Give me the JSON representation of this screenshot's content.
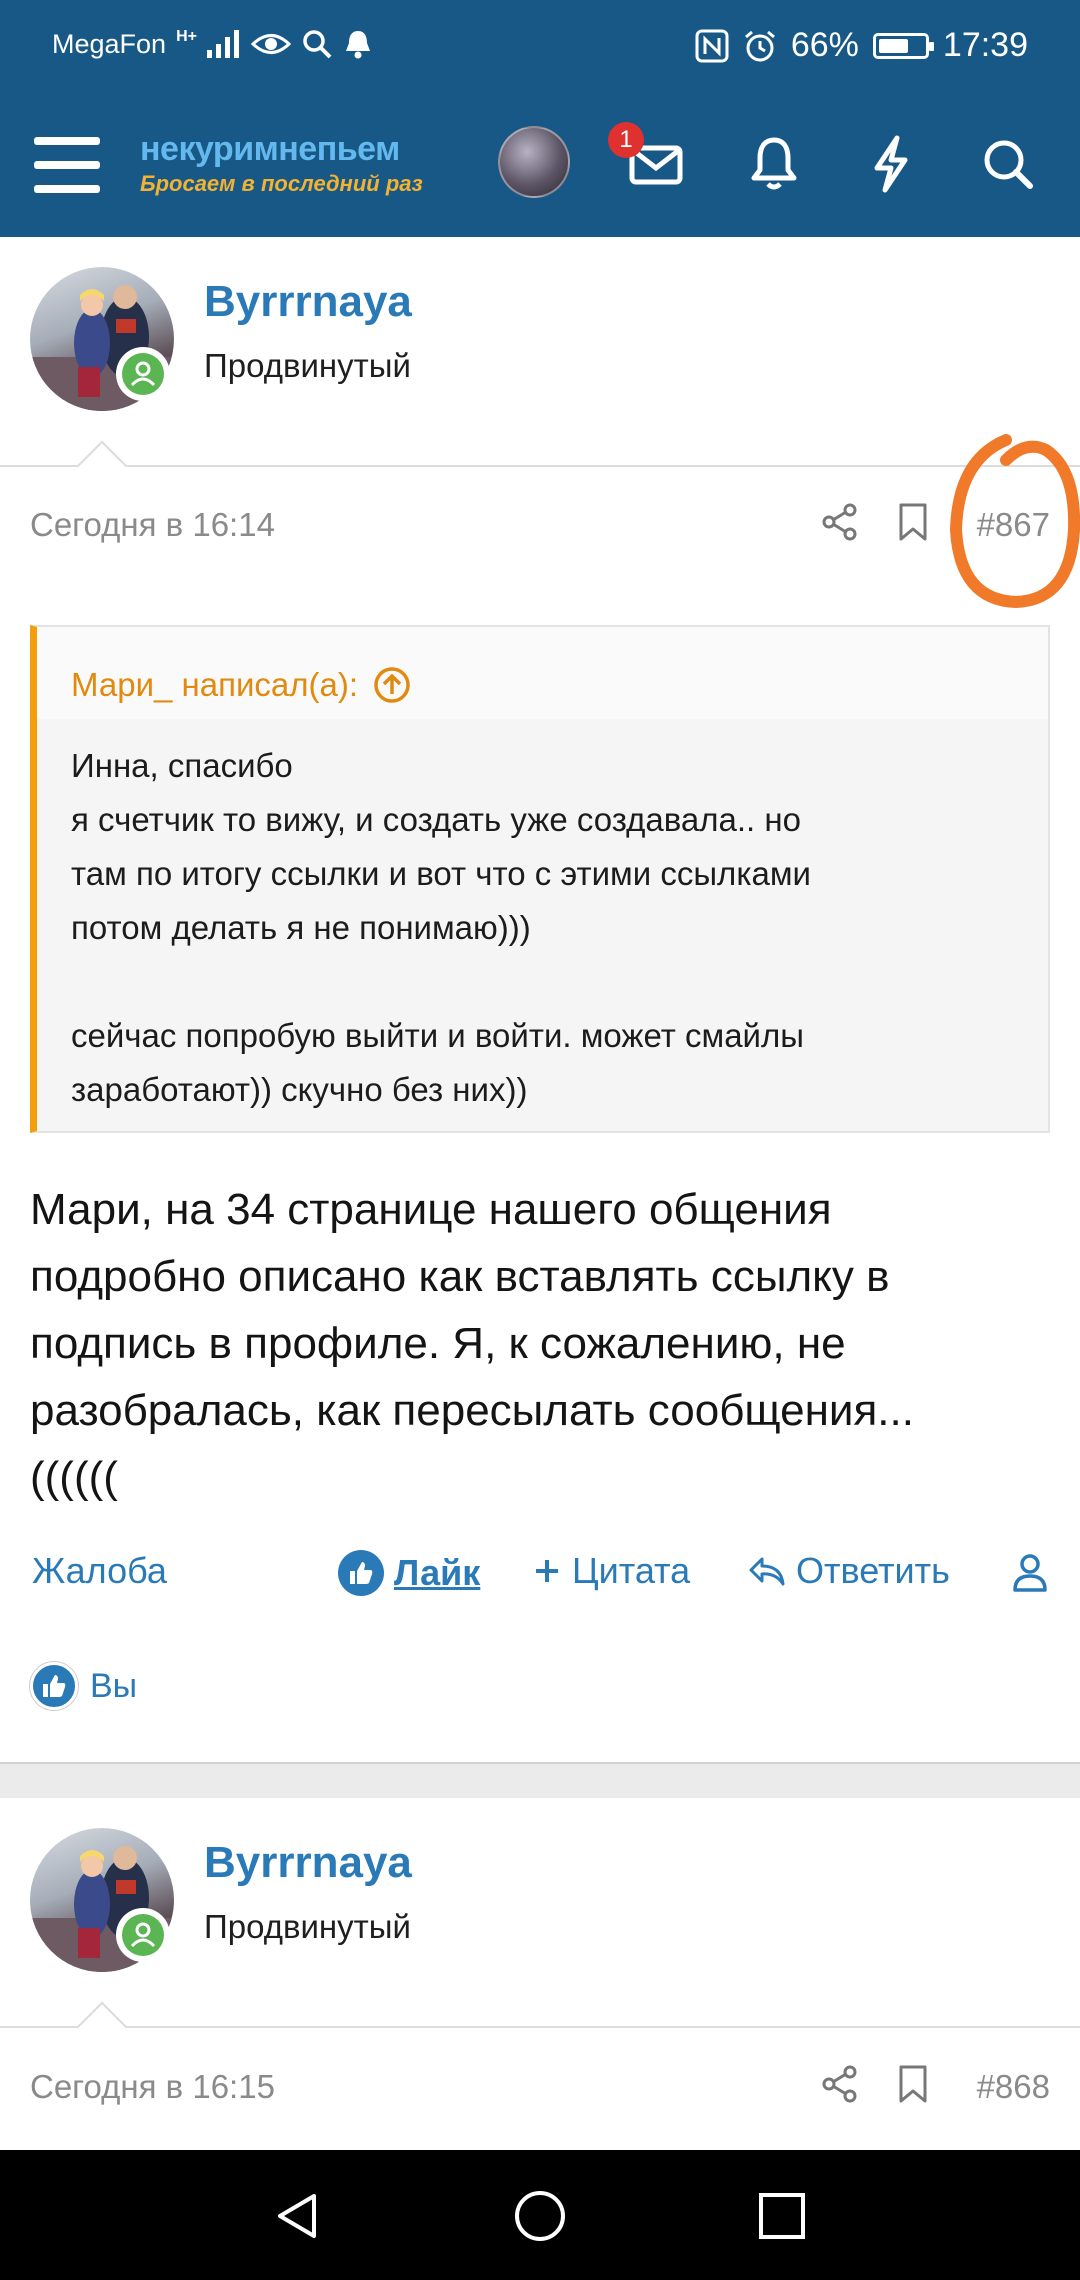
{
  "status_bar": {
    "carrier": "MegaFon",
    "network": "H+",
    "battery": "66%",
    "battery_level": 0.66,
    "time": "17:39"
  },
  "header": {
    "logo_top": "некуримнепьем",
    "logo_bottom": "Бросаем в последний раз",
    "messages_badge": "1",
    "icons": [
      "menu-icon",
      "avatar",
      "mail-icon",
      "bell-icon",
      "lightning-icon",
      "search-icon"
    ]
  },
  "post1": {
    "author": "Byrrrnaya",
    "role": "Продвинутый",
    "date": "Сегодня в 16:14",
    "number": "#867",
    "quote": {
      "author_line": "Мари_ написал(а):",
      "lines1": [
        "Инна, спасибо",
        "я счетчик то вижу, и создать уже создавала.. но",
        "там по итогу ссылки и вот что с этими ссылками",
        "потом делать я не понимаю)))"
      ],
      "lines2": [
        "сейчас попробую выйти и войти. может смайлы",
        "заработают)) скучно без них))"
      ]
    },
    "text_lines": [
      "Мари, на 34 странице нашего общения",
      "подробно описано как вставлять ссылку в",
      "подпись в профиле. Я, к сожалению, не",
      "разобралась, как пересылать сообщения...",
      "(((((("
    ],
    "actions": {
      "report": "Жалоба",
      "like": "Лайк",
      "quote": "Цитата",
      "reply": "Ответить"
    },
    "liked_by": "Вы"
  },
  "post2": {
    "author": "Byrrrnaya",
    "role": "Продвинутый",
    "date": "Сегодня в 16:15",
    "number": "#868"
  },
  "colors": {
    "header_bg": "#185886",
    "link": "#2b7ab8",
    "quote_accent": "#f29e0d",
    "annotation": "#f07a2a",
    "online": "#5ab552"
  }
}
